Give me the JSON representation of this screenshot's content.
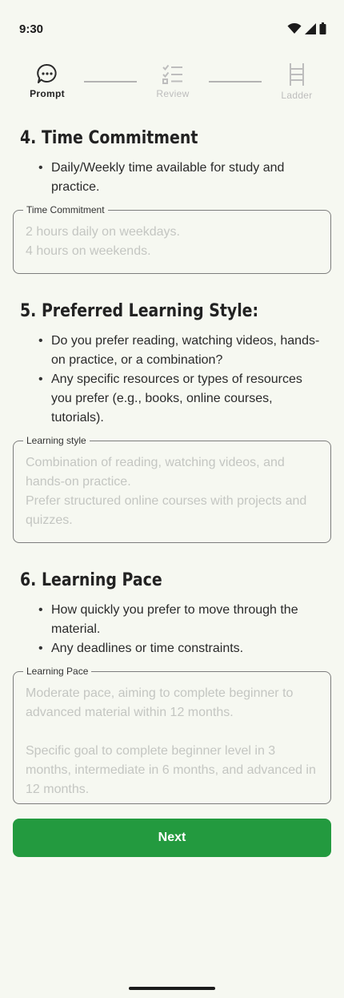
{
  "status_bar": {
    "time": "9:30"
  },
  "stepper": {
    "steps": [
      {
        "label": "Prompt",
        "icon": "chat-bubble-icon",
        "active": true
      },
      {
        "label": "Review",
        "icon": "checklist-icon",
        "active": false
      },
      {
        "label": "Ladder",
        "icon": "ladder-icon",
        "active": false
      }
    ]
  },
  "sections": [
    {
      "title": "4.  Time Commitment",
      "bullets": [
        "Daily/Weekly time available for study and practice."
      ],
      "field": {
        "label": "Time Commitment",
        "placeholder": "2 hours daily on weekdays.\n4 hours on weekends."
      }
    },
    {
      "title": "5.  Preferred Learning Style:",
      "bullets": [
        "Do you prefer reading, watching videos, hands-on practice, or a combination?",
        "Any specific resources or types of resources you prefer (e.g., books, online courses, tutorials)."
      ],
      "field": {
        "label": "Learning style",
        "placeholder": "Combination of reading, watching videos, and hands-on practice.\nPrefer structured online courses with projects and quizzes."
      }
    },
    {
      "title": "6.  Learning Pace",
      "bullets": [
        "How quickly you prefer to move through the material.",
        "Any deadlines or time constraints."
      ],
      "field": {
        "label": "Learning Pace",
        "placeholder": "Moderate pace, aiming to complete beginner to advanced material within 12 months.\n\nSpecific goal to complete beginner level in 3 months, intermediate in 6 months, and advanced in 12 months."
      }
    }
  ],
  "next_label": "Next",
  "colors": {
    "background": "#f6f8f1",
    "accent": "#239a3f",
    "placeholder": "#c4c6c2",
    "inactive": "#bdbdbd"
  }
}
